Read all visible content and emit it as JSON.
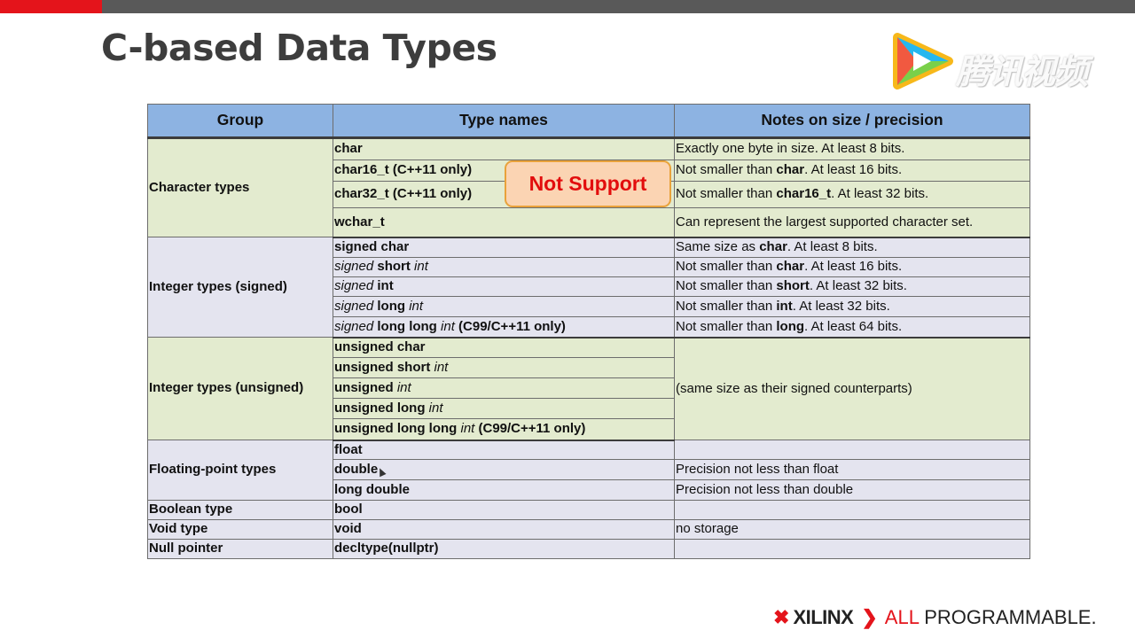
{
  "slide": {
    "title": "C-based Data Types"
  },
  "watermark": {
    "text": "腾讯视频",
    "icon": "play-icon",
    "colors": [
      "#25b7ef",
      "#7ad04a",
      "#f7b81a",
      "#f04f45"
    ]
  },
  "table": {
    "headers": [
      "Group",
      "Type names",
      "Notes on size / precision"
    ],
    "groups": {
      "character": "Character types",
      "signed": "Integer types (signed)",
      "unsigned": "Integer types (unsigned)",
      "floating": "Floating-point types",
      "boolean": "Boolean type",
      "void": "Void type",
      "null": "Null pointer"
    },
    "types": {
      "char": "char",
      "char16": "char16_t (C++11 only)",
      "char32": "char32_t (C++11 only)",
      "wchar": "wchar_t",
      "schar": "signed char",
      "sshort_a": "signed",
      "sshort_b": " short ",
      "sshort_c": "int",
      "sint_a": "signed",
      "sint_b": " int",
      "slong_a": "signed",
      "slong_b": " long ",
      "slong_c": "int",
      "sll_a": "signed",
      "sll_b": " long long ",
      "sll_c": "int",
      "sll_d": "  (C99/C++11 only)",
      "uchar": "unsigned char",
      "ushort_a": "unsigned short ",
      "ushort_b": "int",
      "uint_a": "unsigned ",
      "uint_b": "int",
      "ulong_a": "unsigned long ",
      "ulong_b": "int",
      "ull_a": "unsigned long long ",
      "ull_b": "int",
      "ull_c": " (C99/C++11 only)",
      "float": "float",
      "double": "double",
      "ldouble": "long double",
      "bool": "bool",
      "void": "void",
      "nullptr": "decltype(nullptr)"
    },
    "notes": {
      "char": "Exactly one byte in size. At least 8 bits.",
      "char16_a": "Not smaller than ",
      "char16_b": "char",
      "char16_c": ". At least 16 bits.",
      "char32_a": "Not smaller than ",
      "char32_b": "char16_t",
      "char32_c": ". At least 32 bits.",
      "wchar": "Can represent the largest supported character set.",
      "schar_a": "Same size as ",
      "schar_b": "char",
      "schar_c": ". At least 8 bits.",
      "sshort_a": "Not smaller than ",
      "sshort_b": "char",
      "sshort_c": ". At least 16 bits.",
      "sint_a": "Not smaller than ",
      "sint_b": "short",
      "sint_c": ". At least 32 bits.",
      "slong_a": "Not smaller than ",
      "slong_b": "int",
      "slong_c": ". At least 32 bits.",
      "sll_a": "Not smaller than ",
      "sll_b": "long",
      "sll_c": ". At least 64 bits.",
      "unsigned": "(same size as their signed counterparts)",
      "double": "Precision not less than float",
      "ldouble": "Precision not less than double",
      "void": "no storage"
    }
  },
  "callout": {
    "text": "Not Support",
    "text_color": "#e20d0d",
    "fill": "#fbd4b3"
  },
  "footer": {
    "brand": "XILINX",
    "tagline_a": "ALL",
    "tagline_b": " PROGRAMMABLE."
  },
  "colors": {
    "header_fill": "#8db3e2",
    "green_rows": "#e3ebcf",
    "lavender_rows": "#e4e4ef",
    "brand_red": "#e4141b"
  }
}
